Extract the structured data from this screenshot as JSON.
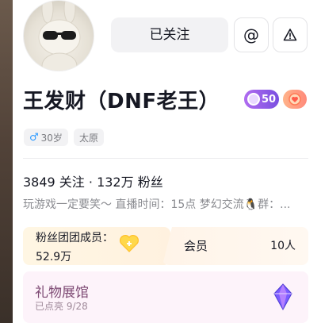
{
  "header": {
    "follow_label": "已关注",
    "at_label": "@"
  },
  "profile": {
    "name": "王发财（DNF老王）",
    "level_badge": "50",
    "tags": {
      "gender_symbol": "♂",
      "age": "30岁",
      "city": "太原"
    },
    "stats": "3849 关注 · 132万 粉丝",
    "bio": "玩游戏一定要笑～ 直播时间：15点 梦幻交流🐧群：..."
  },
  "cards": {
    "fan_club": "粉丝团团成员：52.9万",
    "member_label": "会员",
    "member_count": "10人"
  },
  "gift": {
    "title": "礼物展馆",
    "subtitle": "已点亮 9/28"
  },
  "colors": {
    "follow_bg": "#f2f2f4",
    "badge_purple": "#9b5ef0",
    "gift_title": "#7e4a74"
  },
  "icons": [
    "avatar",
    "at-icon",
    "warning-icon",
    "level-gem-icon",
    "fan-badge-icon",
    "heart-icon",
    "gem-icon"
  ]
}
